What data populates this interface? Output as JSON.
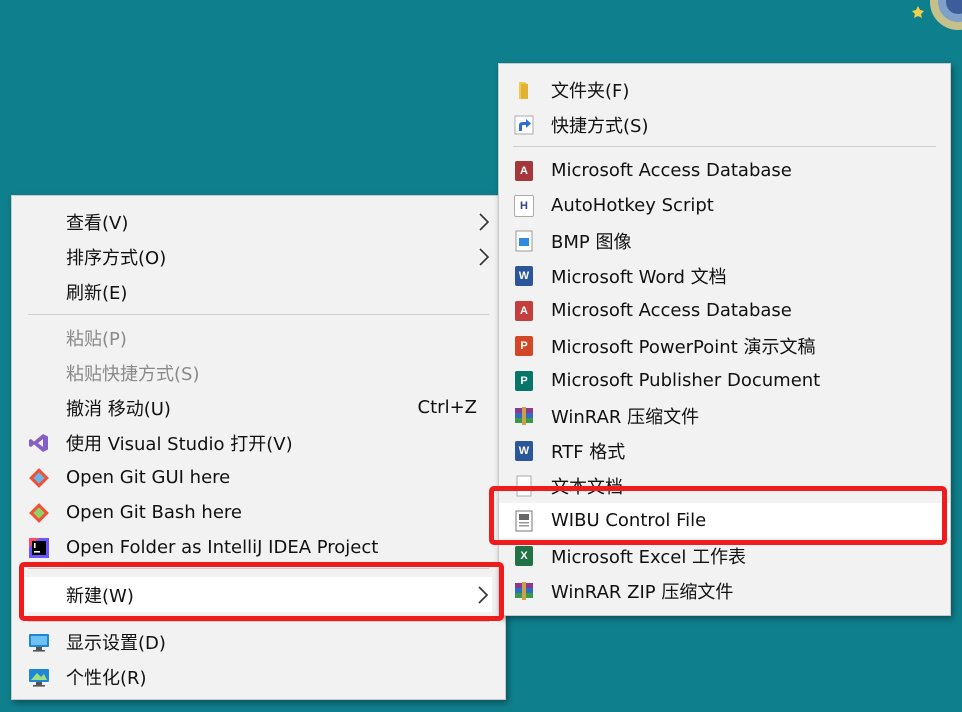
{
  "context_menu": {
    "items": [
      {
        "label": "查看(V)",
        "has_submenu": true
      },
      {
        "label": "排序方式(O)",
        "has_submenu": true
      },
      {
        "label": "刷新(E)"
      },
      {
        "label": "粘贴(P)",
        "disabled": true
      },
      {
        "label": "粘贴快捷方式(S)",
        "disabled": true
      },
      {
        "label": "撤消 移动(U)",
        "shortcut": "Ctrl+Z"
      },
      {
        "label": "使用 Visual Studio 打开(V)",
        "icon": "visual-studio-icon"
      },
      {
        "label": "Open Git GUI here",
        "icon": "git-gui-icon"
      },
      {
        "label": "Open Git Bash here",
        "icon": "git-bash-icon"
      },
      {
        "label": "Open Folder as IntelliJ IDEA Project",
        "icon": "intellij-idea-icon"
      },
      {
        "label": "新建(W)",
        "has_submenu": true,
        "highlighted": true
      },
      {
        "label": "显示设置(D)",
        "icon": "display-settings-icon"
      },
      {
        "label": "个性化(R)",
        "icon": "personalize-icon"
      }
    ]
  },
  "new_submenu": {
    "items": [
      {
        "label": "文件夹(F)",
        "icon": "folder-icon"
      },
      {
        "label": "快捷方式(S)",
        "icon": "shortcut-icon"
      },
      {
        "label": "Microsoft Access Database",
        "icon": "access-icon"
      },
      {
        "label": "AutoHotkey Script",
        "icon": "autohotkey-icon"
      },
      {
        "label": "BMP 图像",
        "icon": "bmp-image-icon"
      },
      {
        "label": "Microsoft Word 文档",
        "icon": "word-icon"
      },
      {
        "label": "Microsoft Access Database",
        "icon": "access-icon"
      },
      {
        "label": "Microsoft PowerPoint 演示文稿",
        "icon": "powerpoint-icon"
      },
      {
        "label": "Microsoft Publisher Document",
        "icon": "publisher-icon"
      },
      {
        "label": "WinRAR 压缩文件",
        "icon": "winrar-icon"
      },
      {
        "label": "RTF 格式",
        "icon": "rtf-icon"
      },
      {
        "label": "文本文档",
        "icon": "text-document-icon"
      },
      {
        "label": "WIBU Control File",
        "icon": "wibu-file-icon",
        "highlighted": true
      },
      {
        "label": "Microsoft Excel 工作表",
        "icon": "excel-icon"
      },
      {
        "label": "WinRAR ZIP 压缩文件",
        "icon": "winrar-zip-icon"
      }
    ]
  },
  "colors": {
    "desktop_background": "#0e7f8c",
    "menu_background": "#f2f2f2",
    "highlight_box": "#ee1c1c"
  }
}
